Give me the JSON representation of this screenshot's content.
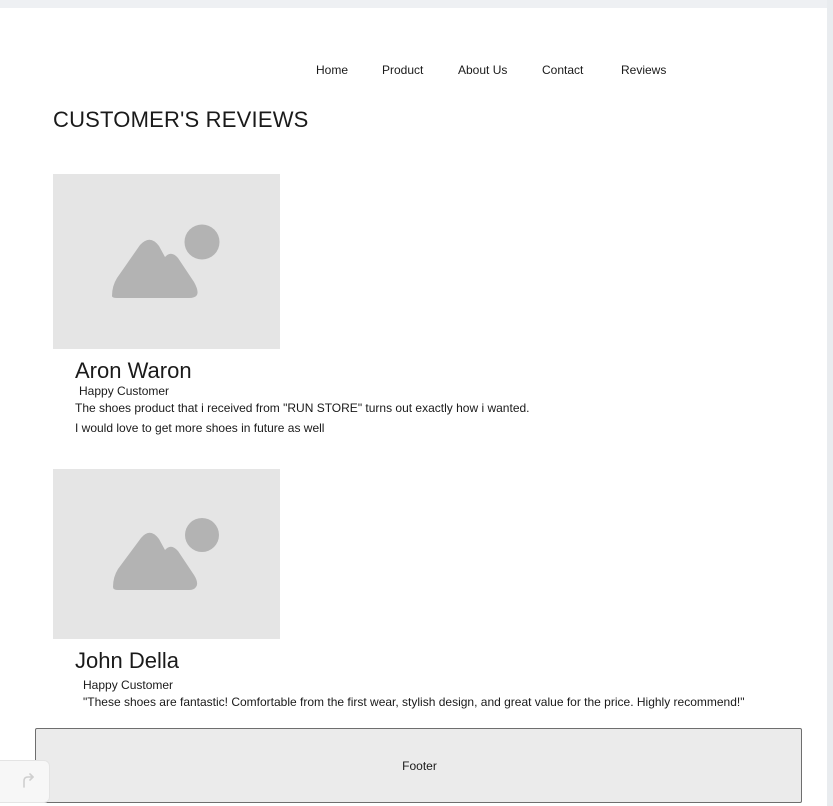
{
  "nav": {
    "items": [
      "Home",
      "Product",
      "About Us",
      "Contact",
      "Reviews"
    ]
  },
  "page": {
    "title": "CUSTOMER'S REVIEWS"
  },
  "reviews": [
    {
      "name": "Aron Waron",
      "role": "Happy Customer",
      "lines": [
        "The shoes product that i received from \"RUN STORE\" turns out exactly how i wanted.",
        "I would love to  get more shoes in future as well"
      ],
      "image_icon": "image-placeholder-icon"
    },
    {
      "name": "John Della",
      "role": "Happy Customer",
      "lines": [
        "\"These shoes are fantastic! Comfortable from the first wear, stylish design, and great value for the price. Highly recommend!\""
      ],
      "image_icon": "image-placeholder-icon"
    }
  ],
  "footer": {
    "label": "Footer"
  },
  "widget": {
    "icon": "redo-icon"
  },
  "colors": {
    "placeholder_bg": "#e5e5e5",
    "placeholder_shape": "#b3b3b3",
    "footer_bg": "#ebebeb"
  }
}
